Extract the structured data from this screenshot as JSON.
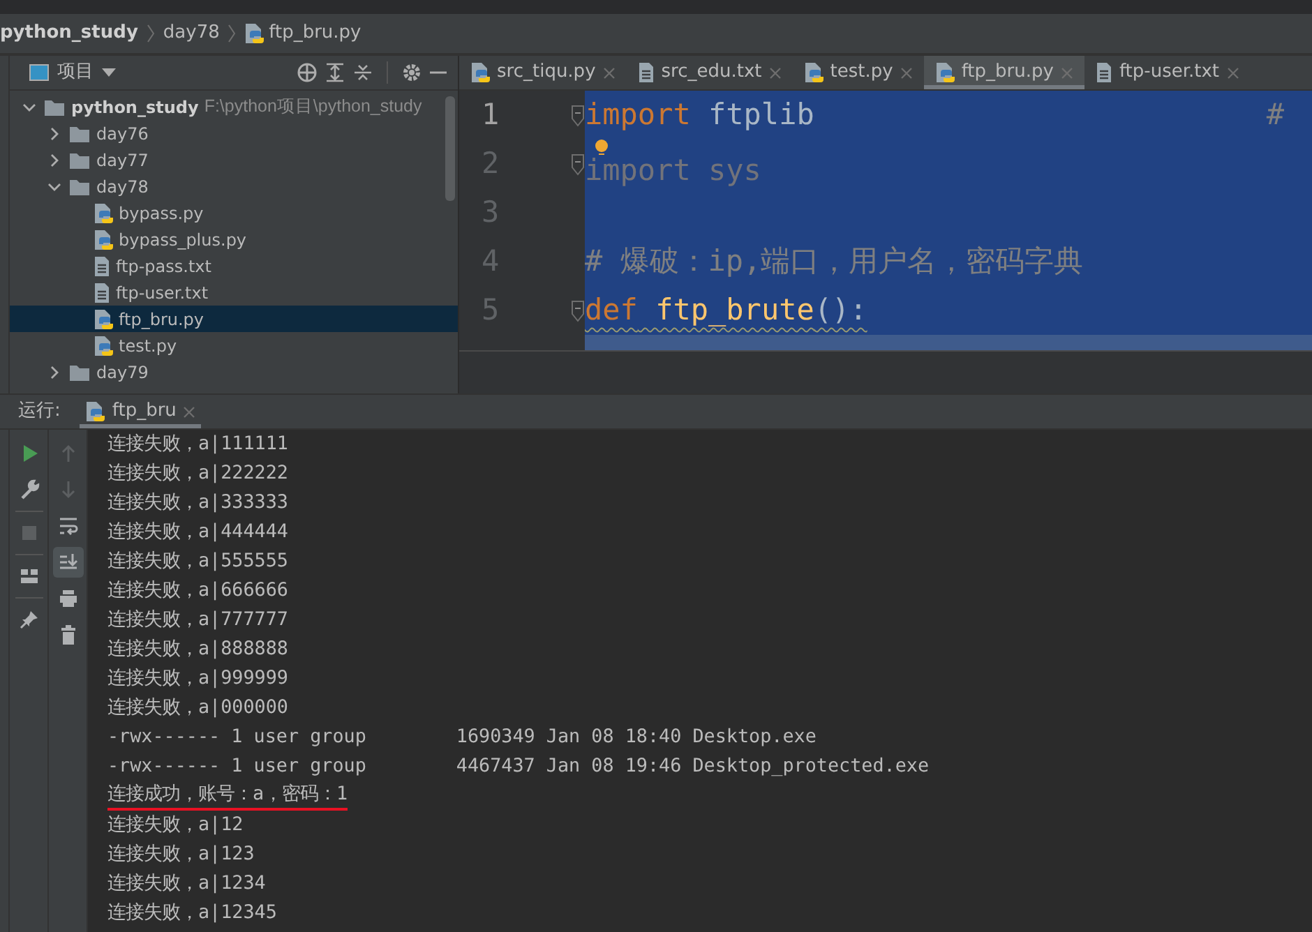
{
  "breadcrumb": [
    {
      "label": "python_study",
      "kind": "folder"
    },
    {
      "label": "day78",
      "kind": "folder"
    },
    {
      "label": "ftp_bru.py",
      "kind": "python"
    }
  ],
  "project_panel": {
    "title": "项目",
    "tree": [
      {
        "name": "python_study",
        "hint": "F:\\python项目\\python_study",
        "kind": "folder",
        "expanded": true,
        "selected": false,
        "children": [
          {
            "name": "day76",
            "kind": "folder",
            "expanded": false,
            "selected": false
          },
          {
            "name": "day77",
            "kind": "folder",
            "expanded": false,
            "selected": false
          },
          {
            "name": "day78",
            "kind": "folder",
            "expanded": true,
            "selected": false,
            "children": [
              {
                "name": "bypass.py",
                "kind": "python",
                "selected": false
              },
              {
                "name": "bypass_plus.py",
                "kind": "python",
                "selected": false
              },
              {
                "name": "ftp-pass.txt",
                "kind": "text",
                "selected": false
              },
              {
                "name": "ftp-user.txt",
                "kind": "text",
                "selected": false
              },
              {
                "name": "ftp_bru.py",
                "kind": "python",
                "selected": true
              },
              {
                "name": "test.py",
                "kind": "python",
                "selected": false
              }
            ]
          },
          {
            "name": "day79",
            "kind": "folder",
            "expanded": false,
            "selected": false
          }
        ]
      }
    ]
  },
  "editor": {
    "tabs": [
      {
        "label": "src_tiqu.py",
        "kind": "python",
        "selected": false
      },
      {
        "label": "src_edu.txt",
        "kind": "text",
        "selected": false
      },
      {
        "label": "test.py",
        "kind": "python",
        "selected": false
      },
      {
        "label": "ftp_bru.py",
        "kind": "python",
        "selected": true
      },
      {
        "label": "ftp-user.txt",
        "kind": "text",
        "selected": false
      }
    ],
    "lines": [
      {
        "number": "1",
        "fold": true,
        "tokens": [
          {
            "text": "import",
            "kind": "keyword"
          },
          {
            "text": " ftplib",
            "kind": "name"
          }
        ],
        "right": "#"
      },
      {
        "number": "2",
        "fold": true,
        "bulb": true,
        "tokens": [
          {
            "text": "import sys",
            "kind": "unused"
          }
        ]
      },
      {
        "number": "3"
      },
      {
        "number": "4",
        "tokens": [
          {
            "text": "# 爆破：ip,端口，用户名，密码字典",
            "kind": "comment"
          }
        ]
      },
      {
        "number": "5",
        "fold": true,
        "warning": true,
        "tokens": [
          {
            "text": "def",
            "kind": "keyword"
          },
          {
            "text": " ftp_brute",
            "kind": "function"
          },
          {
            "text": "():",
            "kind": "name"
          }
        ]
      }
    ]
  },
  "run_panel": {
    "label": "运行:",
    "tab": {
      "label": "ftp_bru",
      "kind": "python",
      "selected": true
    },
    "toolbar_left": [
      {
        "kind": "play",
        "disabled": false
      },
      {
        "kind": "wrench",
        "disabled": false
      },
      {
        "kind": "stop",
        "disabled": true
      },
      {
        "kind": "layout",
        "disabled": false
      },
      {
        "kind": "pin",
        "disabled": false
      }
    ],
    "toolbar_right": [
      {
        "kind": "up",
        "disabled": true,
        "selected": false
      },
      {
        "kind": "down",
        "disabled": true,
        "selected": false
      },
      {
        "kind": "wrap",
        "disabled": false,
        "selected": false
      },
      {
        "kind": "scroll-end",
        "disabled": false,
        "selected": true
      },
      {
        "kind": "print",
        "disabled": false,
        "selected": false
      },
      {
        "kind": "trash",
        "disabled": false,
        "selected": false
      }
    ],
    "output": [
      {
        "text": "连接失败，a|111111",
        "underlined": false
      },
      {
        "text": "连接失败，a|222222",
        "underlined": false
      },
      {
        "text": "连接失败，a|333333",
        "underlined": false
      },
      {
        "text": "连接失败，a|444444",
        "underlined": false
      },
      {
        "text": "连接失败，a|555555",
        "underlined": false
      },
      {
        "text": "连接失败，a|666666",
        "underlined": false
      },
      {
        "text": "连接失败，a|777777",
        "underlined": false
      },
      {
        "text": "连接失败，a|888888",
        "underlined": false
      },
      {
        "text": "连接失败，a|999999",
        "underlined": false
      },
      {
        "text": "连接失败，a|000000",
        "underlined": false
      },
      {
        "text": "-rwx------ 1 user group        1690349 Jan 08 18:40 Desktop.exe",
        "underlined": false
      },
      {
        "text": "-rwx------ 1 user group        4467437 Jan 08 19:46 Desktop_protected.exe",
        "underlined": false
      },
      {
        "text": "连接成功，账号：a，密码：1",
        "underlined": true
      },
      {
        "text": "连接失败，a|12",
        "underlined": false
      },
      {
        "text": "连接失败，a|123",
        "underlined": false
      },
      {
        "text": "连接失败，a|1234",
        "underlined": false
      },
      {
        "text": "连接失败，a|12345",
        "underlined": false
      }
    ]
  }
}
